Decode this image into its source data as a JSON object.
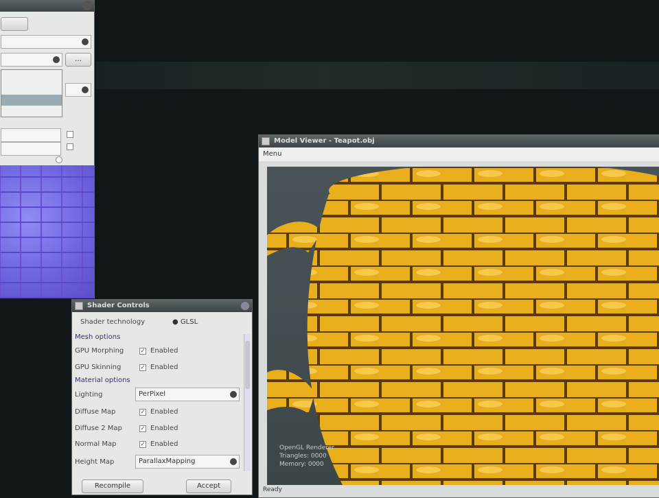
{
  "top_left_window": {
    "title": "",
    "tab_label": "",
    "list_selected": ""
  },
  "shader_window": {
    "title": "Shader Controls",
    "technology_label": "Shader technology",
    "technology_value": "GLSL",
    "mesh_section": "Mesh options",
    "material_section": "Material options",
    "rows": [
      {
        "label": "GPU Morphing",
        "value": "Enabled",
        "type": "check"
      },
      {
        "label": "GPU Skinning",
        "value": "Enabled",
        "type": "check"
      },
      {
        "label": "Lighting",
        "value": "PerPixel",
        "type": "select"
      },
      {
        "label": "Diffuse Map",
        "value": "Enabled",
        "type": "check"
      },
      {
        "label": "Diffuse 2 Map",
        "value": "Enabled",
        "type": "check"
      },
      {
        "label": "Normal Map",
        "value": "Enabled",
        "type": "check"
      },
      {
        "label": "Height Map",
        "value": "ParallaxMapping",
        "type": "select"
      }
    ],
    "recompile_label": "Recompile",
    "accept_label": "Accept"
  },
  "viewer": {
    "title": "Model Viewer - Teapot.obj",
    "menu_label": "Menu",
    "stats": [
      "OpenGL Renderer",
      "Triangles: 0000",
      "Memory: 0000"
    ],
    "status": "Ready"
  },
  "colors": {
    "teapot": "#e8b020",
    "normal_map": "#7a6fe0"
  }
}
